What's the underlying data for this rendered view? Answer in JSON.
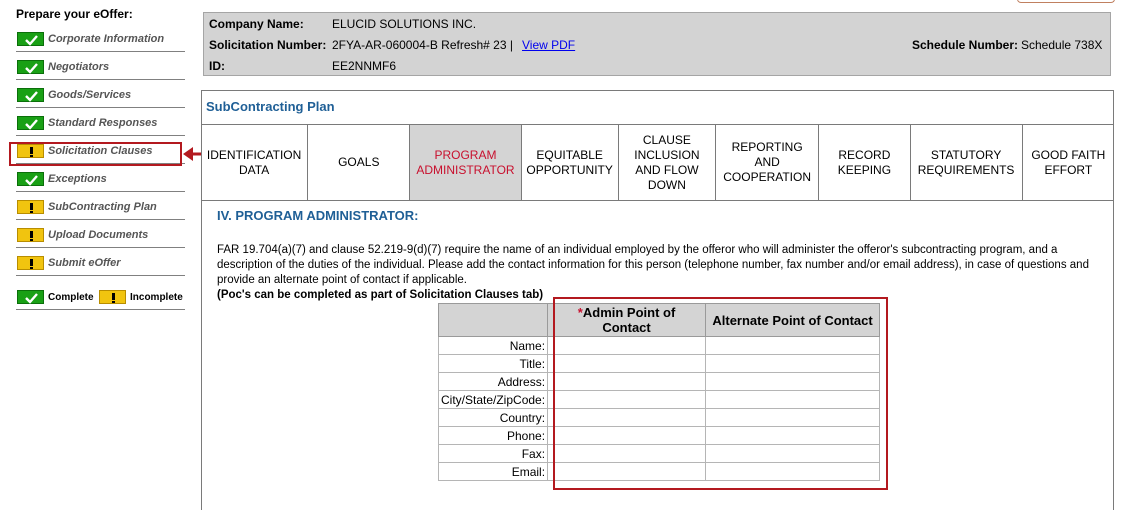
{
  "sidebar": {
    "heading": "Prepare your eOffer:",
    "items": [
      {
        "label": "Corporate Information",
        "status": "complete"
      },
      {
        "label": "Negotiators",
        "status": "complete"
      },
      {
        "label": "Goods/Services",
        "status": "complete"
      },
      {
        "label": "Standard Responses",
        "status": "complete"
      },
      {
        "label": "Solicitation Clauses",
        "status": "incomplete"
      },
      {
        "label": "Exceptions",
        "status": "complete"
      },
      {
        "label": "SubContracting Plan",
        "status": "incomplete"
      },
      {
        "label": "Upload Documents",
        "status": "incomplete"
      },
      {
        "label": "Submit eOffer",
        "status": "incomplete"
      }
    ],
    "legend": {
      "complete_label": "Complete",
      "incomplete_label": "Incomplete"
    }
  },
  "company": {
    "name_label": "Company Name:",
    "name_value": "ELUCID SOLUTIONS INC.",
    "solicitation_label": "Solicitation Number:",
    "solicitation_value": "2FYA-AR-060004-B Refresh# 23 |",
    "view_pdf_label": "View PDF",
    "id_label": "ID:",
    "id_value": "EE2NNMF6",
    "schedule_label": "Schedule Number:",
    "schedule_value": "Schedule 738X"
  },
  "main": {
    "title": "SubContracting Plan",
    "tabs": [
      {
        "label": "IDENTIFICATION\nDATA"
      },
      {
        "label": "GOALS"
      },
      {
        "label": "PROGRAM\nADMINISTRATOR"
      },
      {
        "label": "EQUITABLE\nOPPORTUNITY"
      },
      {
        "label": "CLAUSE\nINCLUSION\nAND FLOW\nDOWN"
      },
      {
        "label": "REPORTING\nAND\nCOOPERATION"
      },
      {
        "label": "RECORD\nKEEPING"
      },
      {
        "label": "STATUTORY\nREQUIREMENTS"
      },
      {
        "label": "GOOD FAITH\nEFFORT"
      }
    ],
    "active_tab": "PROGRAM\nADMINISTRATOR",
    "section_heading": "IV. PROGRAM ADMINISTRATOR:",
    "paragraph": "FAR 19.704(a)(7) and clause 52.219-9(d)(7) require the name of an individual employed by the offeror who will administer the offeror's subcontracting program, and a description of the duties of the individual. Please add the contact information for this person (telephone number, fax number and/or email address), in case of questions and provide an alternate point of contact if applicable.",
    "note": "(Poc's can be completed as part of Solicitation Clauses tab)",
    "poc_table": {
      "required_mark": "*",
      "col1_header": "Admin Point of Contact",
      "col2_header": "Alternate Point of Contact",
      "rows": [
        "Name:",
        "Title:",
        "Address:",
        "City/State/ZipCode:",
        "Country:",
        "Phone:",
        "Fax:",
        "Email:"
      ]
    }
  },
  "colors": {
    "accent_blue": "#1f5f96",
    "active_tab_text": "#c8102e",
    "highlight_red": "#b3191f",
    "complete_green": "#19a015",
    "incomplete_yellow": "#f1c40f"
  }
}
